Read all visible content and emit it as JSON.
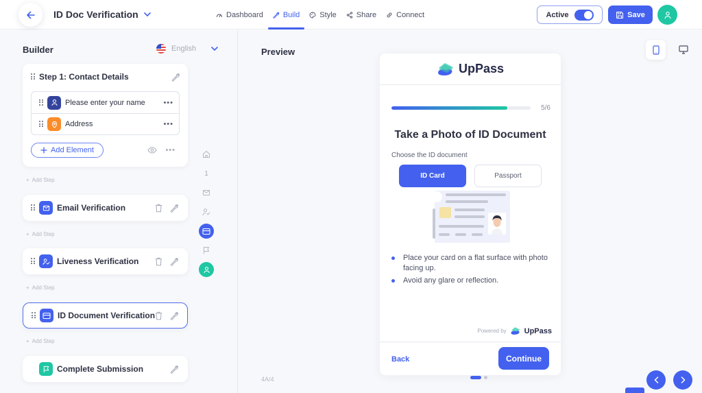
{
  "header": {
    "title": "ID Doc Verification",
    "nav": [
      {
        "label": "Dashboard",
        "icon": "dashboard-icon",
        "active": false
      },
      {
        "label": "Build",
        "icon": "wrench-icon",
        "active": true
      },
      {
        "label": "Style",
        "icon": "palette-icon",
        "active": false
      },
      {
        "label": "Share",
        "icon": "share-icon",
        "active": false
      },
      {
        "label": "Connect",
        "icon": "link-icon",
        "active": false
      }
    ],
    "active_toggle": {
      "label": "Active",
      "on": true
    },
    "save_label": "Save"
  },
  "builder": {
    "title": "Builder",
    "language": "English",
    "add_step_label": "Add Step",
    "step1": {
      "title": "Step 1: Contact Details",
      "fields": [
        {
          "label": "Please enter your name",
          "icon": "user-icon",
          "color": "#34449c"
        },
        {
          "label": "Address",
          "icon": "location-pin-icon",
          "color": "#fb8c2a"
        }
      ],
      "add_element_label": "Add Element"
    },
    "steps": [
      {
        "label": "Email Verification",
        "icon": "mail-icon",
        "color": "#4361ee"
      },
      {
        "label": "Liveness Verification",
        "icon": "user-check-icon",
        "color": "#4361ee"
      },
      {
        "label": "ID Document Verification",
        "icon": "id-card-icon",
        "color": "#4361ee",
        "selected": true
      },
      {
        "label": "Complete Submission",
        "icon": "flag-icon",
        "color": "#1fc7a3"
      }
    ],
    "rail": [
      {
        "icon": "home-icon"
      },
      {
        "text": "1"
      },
      {
        "icon": "mail-icon"
      },
      {
        "icon": "user-check-icon"
      },
      {
        "icon": "id-card-icon",
        "state": "active"
      },
      {
        "icon": "flag-icon"
      },
      {
        "icon": "user-icon",
        "state": "done"
      }
    ]
  },
  "preview": {
    "title": "Preview",
    "brand": "UpPass",
    "progress": {
      "current": 5,
      "total": 6,
      "text": "5/6"
    },
    "doc_title": "Take a Photo of ID Document",
    "choose_label": "Choose the ID document",
    "options": [
      {
        "label": "ID Card",
        "selected": true
      },
      {
        "label": "Passport",
        "selected": false
      }
    ],
    "tips": [
      "Place your card on a flat surface with photo facing up.",
      "Avoid any glare or reflection."
    ],
    "powered_by": "Powered by",
    "back_label": "Back",
    "continue_label": "Continue",
    "page_count": "4A/4"
  },
  "colors": {
    "accent": "#4361ee",
    "success": "#1fc7a3",
    "warning": "#fb8c2a"
  }
}
